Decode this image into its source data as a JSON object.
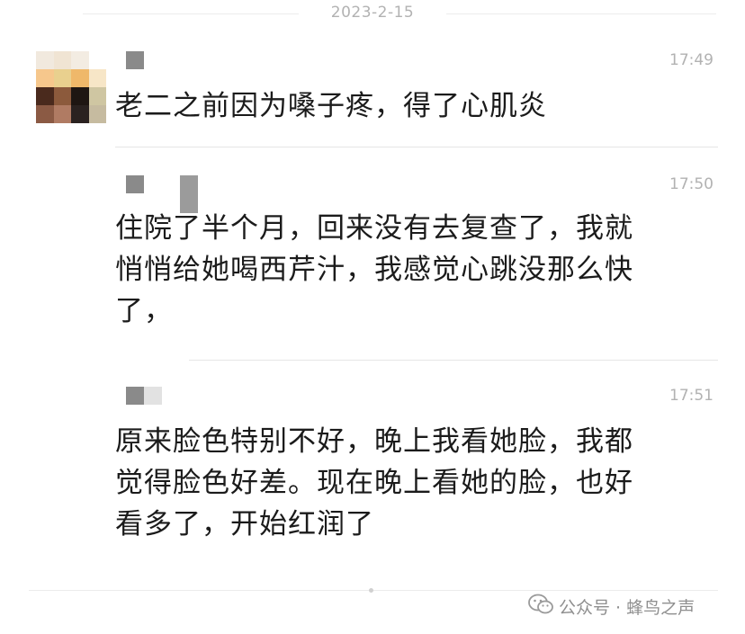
{
  "chat": {
    "date": "2023-2-15",
    "messages": [
      {
        "time": "17:49",
        "text": "老二之前因为嗓子疼，得了心肌炎"
      },
      {
        "time": "17:50",
        "text": "住院了半个月，回来没有去复查了，我就\n悄悄给她喝西芹汁，我感觉心跳没那么快\n了，"
      },
      {
        "time": "17:51",
        "text": "原来脸色特别不好，晚上我看她脸，我都\n觉得脸色好差。现在晚上看她的脸，也好\n看多了，开始红润了"
      }
    ]
  },
  "watermark": {
    "icon": "wechat-icon",
    "text": "公众号 · 蜂鸟之声"
  },
  "colors": {
    "timestamp": "#b2b2b2",
    "message_text": "#1b1b1b",
    "divider": "#e6e6e6",
    "watermark": "#8f8f8f",
    "redaction": "#8a8a8a"
  }
}
